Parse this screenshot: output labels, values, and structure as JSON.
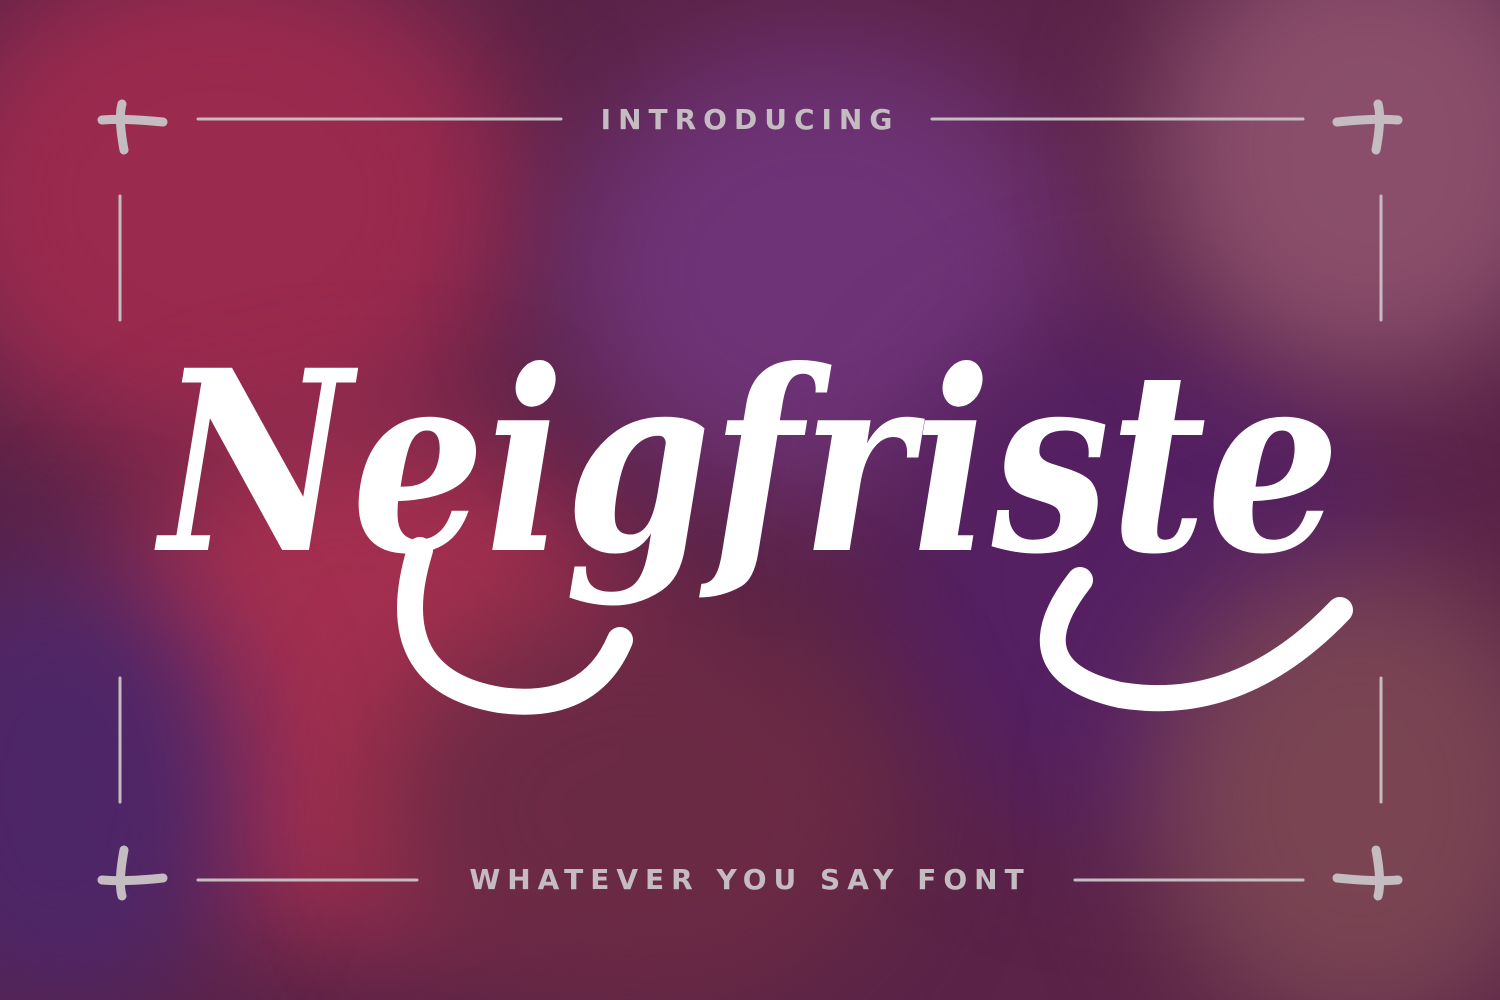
{
  "intro_text": "INTRODUCING",
  "title_text": "Neigfriste",
  "tagline_text": "WHATEVER YOU SAY FONT",
  "colors": {
    "background": "#5a2347",
    "title": "#ffffff",
    "frame": "#c4bcc1"
  }
}
